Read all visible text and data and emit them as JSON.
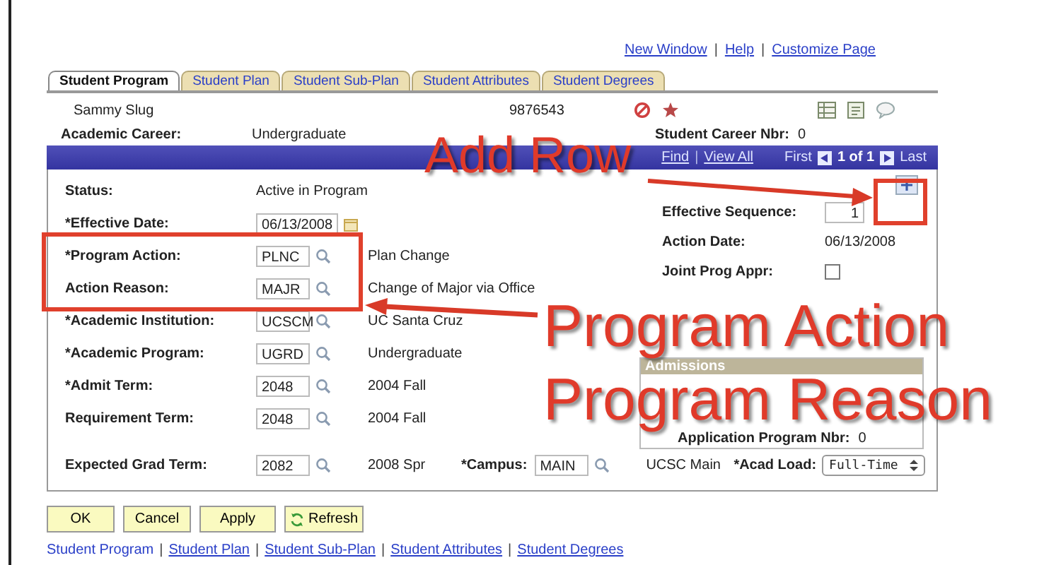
{
  "header_links": [
    {
      "kind": "link",
      "text": "New Window"
    },
    {
      "kind": "separator",
      "text": "|"
    },
    {
      "kind": "link",
      "text": "Help"
    },
    {
      "kind": "separator",
      "text": "|"
    },
    {
      "kind": "link",
      "text": "Customize Page"
    }
  ],
  "tabs": [
    {
      "label": "Student Program",
      "selected": true
    },
    {
      "label": "Student Plan",
      "selected": false
    },
    {
      "label": "Student Sub-Plan",
      "selected": false
    },
    {
      "label": "Student Attributes",
      "selected": false
    },
    {
      "label": "Student Degrees",
      "selected": false
    }
  ],
  "student": {
    "name": "Sammy Slug",
    "id": "9876543"
  },
  "career": {
    "label": "Academic Career:",
    "value": "Undergraduate",
    "nbr_label": "Student Career Nbr:",
    "nbr": "0"
  },
  "nav": {
    "links": [
      {
        "kind": "link",
        "text": "Find"
      },
      {
        "kind": "separator",
        "text": "|"
      },
      {
        "kind": "link",
        "text": "View All"
      }
    ],
    "first": "First",
    "count": "1 of 1",
    "last": "Last"
  },
  "fields": [
    {
      "label": "Status:",
      "kind": "text",
      "value": "Active in Program"
    },
    {
      "label": "*Effective Date:",
      "kind": "date",
      "value": "06/13/2008"
    },
    {
      "label": "*Program Action:",
      "kind": "lookup",
      "value": "PLNC",
      "description": "Plan Change"
    },
    {
      "label": "Action Reason:",
      "kind": "lookup",
      "value": "MAJR",
      "description": "Change of Major via Office"
    },
    {
      "label": "*Academic Institution:",
      "kind": "lookup",
      "value": "UCSCM",
      "description": "UC Santa Cruz"
    },
    {
      "label": "*Academic Program:",
      "kind": "lookup",
      "value": "UGRD",
      "description": "Undergraduate"
    },
    {
      "label": "*Admit Term:",
      "kind": "lookup",
      "value": "2048",
      "description": "2004 Fall"
    },
    {
      "label": "Requirement Term:",
      "kind": "lookup",
      "value": "2048",
      "description": "2004 Fall"
    }
  ],
  "grad_term": {
    "label": "Expected Grad Term:",
    "value": "2082",
    "description": "2008 Spr"
  },
  "campus": {
    "label": "*Campus:",
    "value": "MAIN",
    "description": "UCSC Main"
  },
  "acad_load": {
    "label": "*Acad Load:",
    "value": "Full-Time"
  },
  "effective_sequence": {
    "label": "Effective Sequence:",
    "value": "1"
  },
  "action_date": {
    "label": "Action Date:",
    "value": "06/13/2008"
  },
  "joint_prog_appr": {
    "label": "Joint Prog Appr:",
    "checked": false
  },
  "admissions": {
    "title": "Admissions",
    "program_nbr_label": "Application Program Nbr:",
    "program_nbr": "0"
  },
  "buttons": [
    {
      "label": "OK",
      "kind": "plain"
    },
    {
      "label": "Cancel",
      "kind": "plain"
    },
    {
      "label": "Apply",
      "kind": "plain"
    },
    {
      "label": "Refresh",
      "kind": "refresh"
    }
  ],
  "footer_links": [
    {
      "kind": "link",
      "text": "Student Program",
      "selected": true
    },
    {
      "kind": "separator",
      "text": "|"
    },
    {
      "kind": "link",
      "text": "Student Plan",
      "selected": false
    },
    {
      "kind": "separator",
      "text": "|"
    },
    {
      "kind": "link",
      "text": "Student Sub-Plan",
      "selected": false
    },
    {
      "kind": "separator",
      "text": "|"
    },
    {
      "kind": "link",
      "text": "Student Attributes",
      "selected": false
    },
    {
      "kind": "separator",
      "text": "|"
    },
    {
      "kind": "link",
      "text": "Student Degrees",
      "selected": false
    }
  ],
  "annotations": [
    {
      "text": "Add Row"
    },
    {
      "text": "Program Action"
    },
    {
      "text": "Program Reason"
    }
  ]
}
